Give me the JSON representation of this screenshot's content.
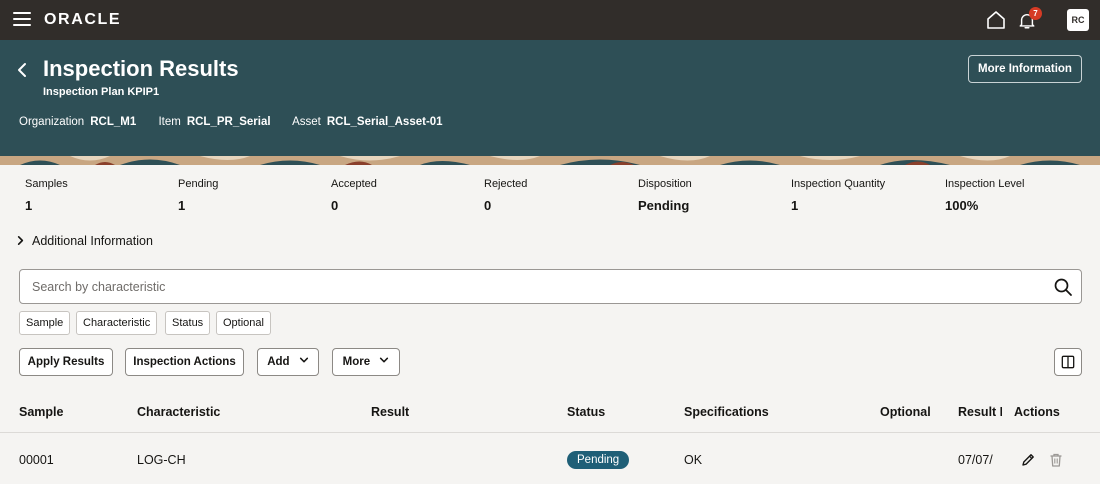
{
  "app": {
    "logo": "ORACLE",
    "notification_count": "7",
    "user_initials": "RC"
  },
  "header": {
    "title": "Inspection Results",
    "subtitle": "Inspection Plan KPIP1",
    "fields": [
      {
        "label": "Organization",
        "value": "RCL_M1"
      },
      {
        "label": "Item",
        "value": "RCL_PR_Serial"
      },
      {
        "label": "Asset",
        "value": "RCL_Serial_Asset-01"
      }
    ],
    "more_info_label": "More Information"
  },
  "metrics": [
    {
      "label": "Samples",
      "value": "1"
    },
    {
      "label": "Pending",
      "value": "1"
    },
    {
      "label": "Accepted",
      "value": "0"
    },
    {
      "label": "Rejected",
      "value": "0"
    },
    {
      "label": "Disposition",
      "value": "Pending"
    },
    {
      "label": "Inspection Quantity",
      "value": "1"
    },
    {
      "label": "Inspection Level",
      "value": "100%"
    }
  ],
  "additional_info_label": "Additional Information",
  "search": {
    "placeholder": "Search by characteristic"
  },
  "filters": [
    "Sample",
    "Characteristic",
    "Status",
    "Optional"
  ],
  "toolbar": {
    "apply_results": "Apply Results",
    "inspection_actions": "Inspection Actions",
    "add": "Add",
    "more": "More"
  },
  "table": {
    "columns": [
      "Sample",
      "Characteristic",
      "Result",
      "Status",
      "Specifications",
      "Optional",
      "Result D",
      "Actions"
    ],
    "rows": [
      {
        "sample": "00001",
        "characteristic": "LOG-CH",
        "result": "",
        "status": "Pending",
        "specifications": "OK",
        "optional": "",
        "result_date": "07/07/"
      }
    ]
  },
  "colors": {
    "topbar": "#312d2a",
    "header": "#2e4f56",
    "status_pending": "#1f5f77",
    "badge": "#d63b25"
  },
  "icons": [
    "menu-icon",
    "home-icon",
    "bell-icon",
    "back-icon",
    "search-icon",
    "chevron-right-icon",
    "chevron-down-icon",
    "columns-icon",
    "edit-icon",
    "delete-icon"
  ]
}
